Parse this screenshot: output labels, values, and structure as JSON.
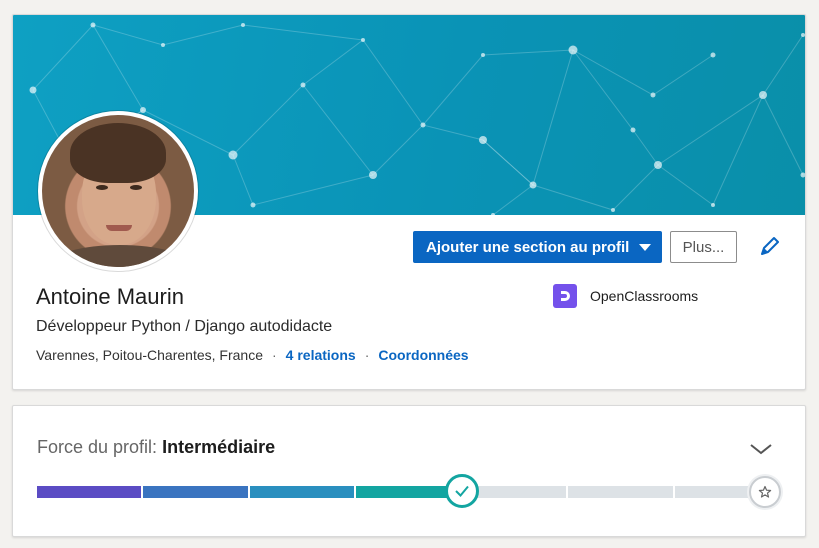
{
  "profile": {
    "name": "Antoine Maurin",
    "headline": "Développeur Python / Django autodidacte",
    "location": "Varennes, Poitou-Charentes, France",
    "relations_label": "4 relations",
    "contact_label": "Coordonnées",
    "school": "OpenClassrooms",
    "add_section_label": "Ajouter une section au profil",
    "more_label": "Plus..."
  },
  "strength": {
    "label": "Force du profil:",
    "level": "Intermédiaire",
    "steps_total": 7,
    "steps_done": 4,
    "segment_colors": [
      "#5b4cc4",
      "#3a74c0",
      "#2a8fbf",
      "#13a5a1"
    ],
    "empty_color": "#dde2e6"
  },
  "colors": {
    "primary": "#0a66c2",
    "banner": "#0ea0c3",
    "school_logo": "#7451eb",
    "check": "#13a5a1"
  },
  "icons": {
    "edit": "pencil-icon",
    "dropdown": "caret-down-icon",
    "expand": "chevron-down-icon",
    "complete": "checkmark-icon",
    "goal": "star-icon"
  }
}
